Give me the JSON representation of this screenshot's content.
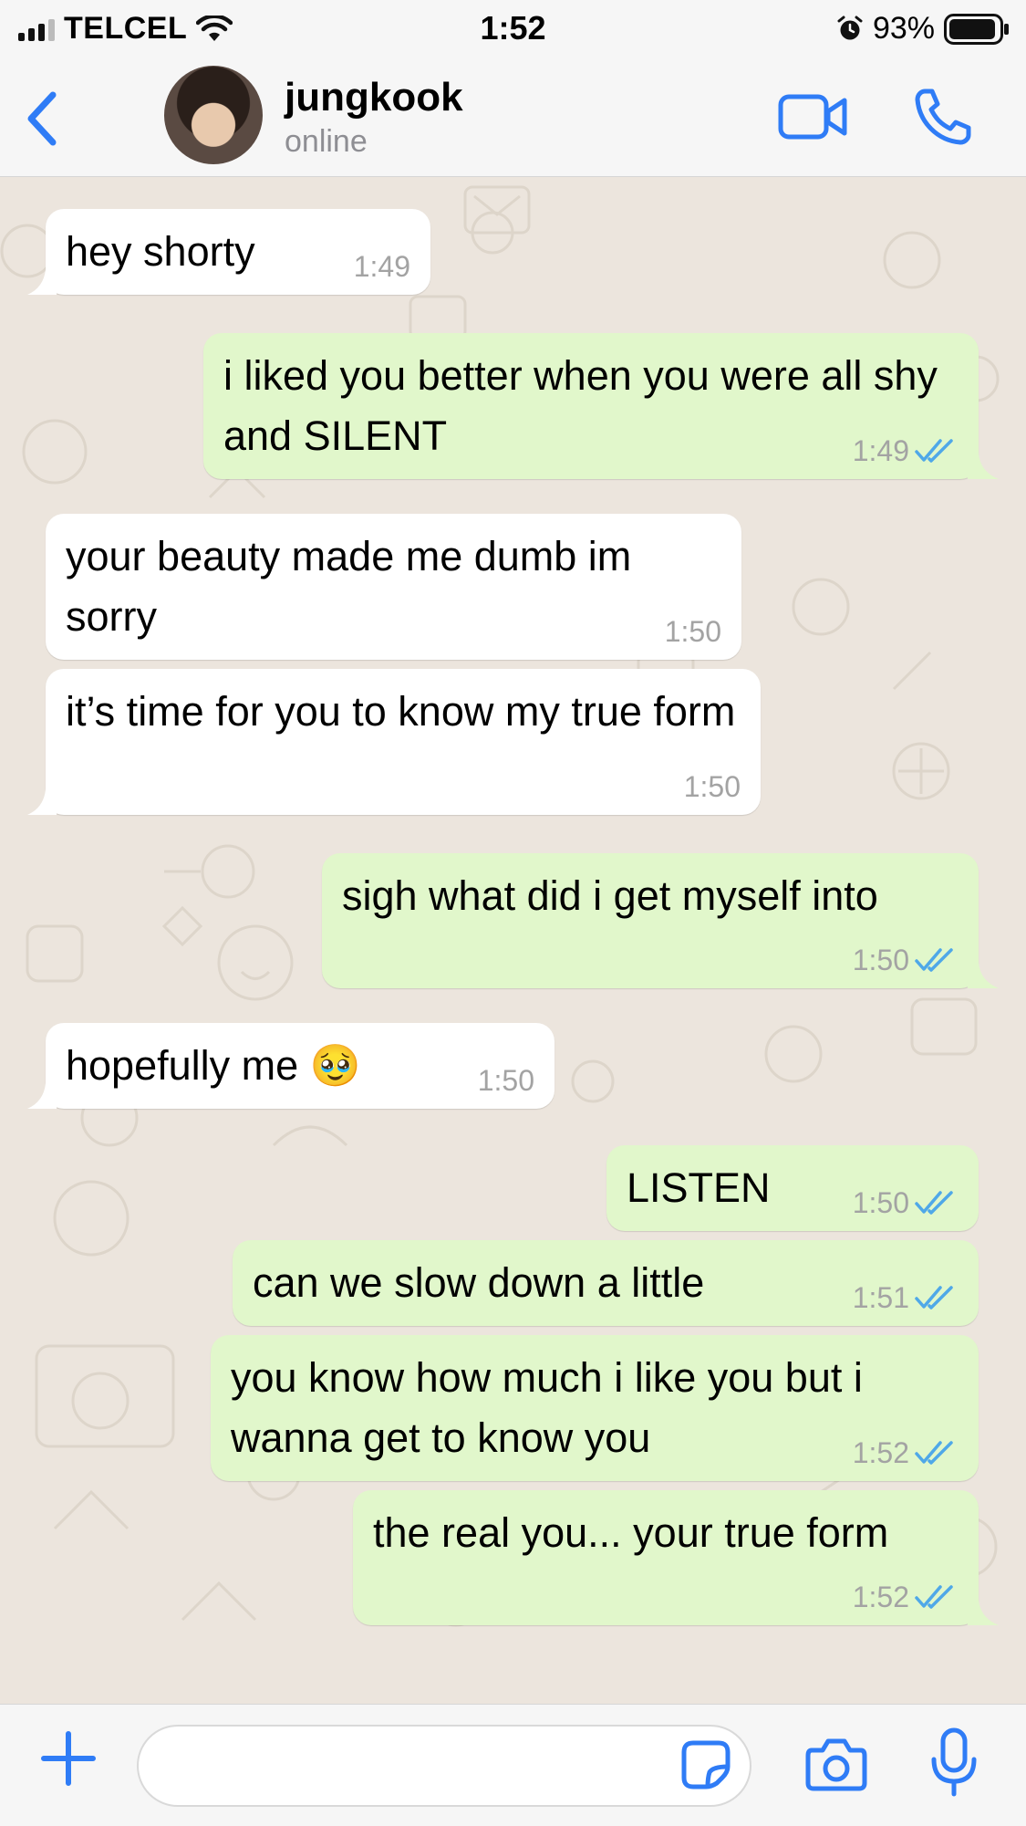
{
  "status_bar": {
    "carrier": "TELCEL",
    "time": "1:52",
    "battery": "93%"
  },
  "header": {
    "contact_name": "jungkook",
    "contact_status": "online"
  },
  "colors": {
    "accent": "#2F7CF6",
    "outgoing_bubble": "#E1F7CB",
    "incoming_bubble": "#FFFFFF",
    "read_tick": "#4FA8E8",
    "chat_background": "#ECE5DD"
  },
  "messages": [
    {
      "direction": "in",
      "text": "hey shorty",
      "time": "1:49"
    },
    {
      "direction": "out",
      "text": "i liked you better when you were all shy and SILENT",
      "time": "1:49",
      "read": true
    },
    {
      "direction": "in",
      "text": "your beauty made me dumb im sorry",
      "time": "1:50"
    },
    {
      "direction": "in",
      "text": "it’s time for you to know my true form",
      "time": "1:50"
    },
    {
      "direction": "out",
      "text": "sigh what did i get myself into",
      "time": "1:50",
      "read": true
    },
    {
      "direction": "in",
      "text": "hopefully me 🥹",
      "time": "1:50"
    },
    {
      "direction": "out",
      "text": "LISTEN",
      "time": "1:50",
      "read": true
    },
    {
      "direction": "out",
      "text": "can we slow down a little",
      "time": "1:51",
      "read": true
    },
    {
      "direction": "out",
      "text": "you know how much i like you but i wanna get to know you",
      "time": "1:52",
      "read": true
    },
    {
      "direction": "out",
      "text": "the real you... your true form",
      "time": "1:52",
      "read": true
    }
  ],
  "input": {
    "placeholder": ""
  },
  "icons": {
    "back": "chevron-left-icon",
    "video": "video-camera-icon",
    "call": "phone-icon",
    "plus": "plus-icon",
    "sticker": "sticker-icon",
    "camera": "camera-icon",
    "mic": "microphone-icon"
  }
}
